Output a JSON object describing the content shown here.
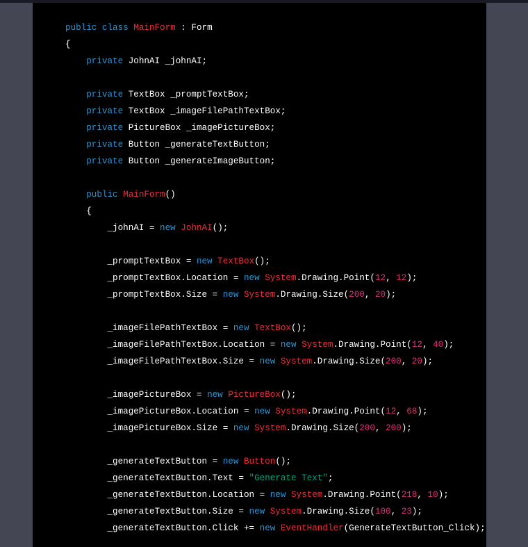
{
  "colors": {
    "keyword": "#2e95d3",
    "type": "#f22c3d",
    "number": "#df3079",
    "string": "#00a67d",
    "plain": "#ffffff"
  },
  "code_lines": [
    [
      [
        "kw",
        "public class "
      ],
      [
        "ty",
        "MainForm"
      ],
      [
        "pl",
        " : Form"
      ]
    ],
    [
      [
        "pl",
        "{"
      ]
    ],
    [
      [
        "kw",
        "    private "
      ],
      [
        "pl",
        "JohnAI _johnAI;"
      ]
    ],
    [],
    [
      [
        "kw",
        "    private "
      ],
      [
        "pl",
        "TextBox _promptTextBox;"
      ]
    ],
    [
      [
        "kw",
        "    private "
      ],
      [
        "pl",
        "TextBox _imageFilePathTextBox;"
      ]
    ],
    [
      [
        "kw",
        "    private "
      ],
      [
        "pl",
        "PictureBox _imagePictureBox;"
      ]
    ],
    [
      [
        "kw",
        "    private "
      ],
      [
        "pl",
        "Button _generateTextButton;"
      ]
    ],
    [
      [
        "kw",
        "    private "
      ],
      [
        "pl",
        "Button _generateImageButton;"
      ]
    ],
    [],
    [
      [
        "kw",
        "    public "
      ],
      [
        "ty",
        "MainForm"
      ],
      [
        "pl",
        "()"
      ]
    ],
    [
      [
        "pl",
        "    {"
      ]
    ],
    [
      [
        "pl",
        "        _johnAI = "
      ],
      [
        "kw",
        "new "
      ],
      [
        "ty",
        "JohnAI"
      ],
      [
        "pl",
        "();"
      ]
    ],
    [],
    [
      [
        "pl",
        "        _promptTextBox = "
      ],
      [
        "kw",
        "new "
      ],
      [
        "ty",
        "TextBox"
      ],
      [
        "pl",
        "();"
      ]
    ],
    [
      [
        "pl",
        "        _promptTextBox.Location = "
      ],
      [
        "kw",
        "new "
      ],
      [
        "ty",
        "System"
      ],
      [
        "pl",
        ".Drawing.Point("
      ],
      [
        "num",
        "12"
      ],
      [
        "pl",
        ", "
      ],
      [
        "num",
        "12"
      ],
      [
        "pl",
        ");"
      ]
    ],
    [
      [
        "pl",
        "        _promptTextBox.Size = "
      ],
      [
        "kw",
        "new "
      ],
      [
        "ty",
        "System"
      ],
      [
        "pl",
        ".Drawing.Size("
      ],
      [
        "num",
        "200"
      ],
      [
        "pl",
        ", "
      ],
      [
        "num",
        "20"
      ],
      [
        "pl",
        ");"
      ]
    ],
    [],
    [
      [
        "pl",
        "        _imageFilePathTextBox = "
      ],
      [
        "kw",
        "new "
      ],
      [
        "ty",
        "TextBox"
      ],
      [
        "pl",
        "();"
      ]
    ],
    [
      [
        "pl",
        "        _imageFilePathTextBox.Location = "
      ],
      [
        "kw",
        "new "
      ],
      [
        "ty",
        "System"
      ],
      [
        "pl",
        ".Drawing.Point("
      ],
      [
        "num",
        "12"
      ],
      [
        "pl",
        ", "
      ],
      [
        "num",
        "40"
      ],
      [
        "pl",
        ");"
      ]
    ],
    [
      [
        "pl",
        "        _imageFilePathTextBox.Size = "
      ],
      [
        "kw",
        "new "
      ],
      [
        "ty",
        "System"
      ],
      [
        "pl",
        ".Drawing.Size("
      ],
      [
        "num",
        "200"
      ],
      [
        "pl",
        ", "
      ],
      [
        "num",
        "20"
      ],
      [
        "pl",
        ");"
      ]
    ],
    [],
    [
      [
        "pl",
        "        _imagePictureBox = "
      ],
      [
        "kw",
        "new "
      ],
      [
        "ty",
        "PictureBox"
      ],
      [
        "pl",
        "();"
      ]
    ],
    [
      [
        "pl",
        "        _imagePictureBox.Location = "
      ],
      [
        "kw",
        "new "
      ],
      [
        "ty",
        "System"
      ],
      [
        "pl",
        ".Drawing.Point("
      ],
      [
        "num",
        "12"
      ],
      [
        "pl",
        ", "
      ],
      [
        "num",
        "68"
      ],
      [
        "pl",
        ");"
      ]
    ],
    [
      [
        "pl",
        "        _imagePictureBox.Size = "
      ],
      [
        "kw",
        "new "
      ],
      [
        "ty",
        "System"
      ],
      [
        "pl",
        ".Drawing.Size("
      ],
      [
        "num",
        "200"
      ],
      [
        "pl",
        ", "
      ],
      [
        "num",
        "200"
      ],
      [
        "pl",
        ");"
      ]
    ],
    [],
    [
      [
        "pl",
        "        _generateTextButton = "
      ],
      [
        "kw",
        "new "
      ],
      [
        "ty",
        "Button"
      ],
      [
        "pl",
        "();"
      ]
    ],
    [
      [
        "pl",
        "        _generateTextButton.Text = "
      ],
      [
        "str",
        "\"Generate Text\""
      ],
      [
        "pl",
        ";"
      ]
    ],
    [
      [
        "pl",
        "        _generateTextButton.Location = "
      ],
      [
        "kw",
        "new "
      ],
      [
        "ty",
        "System"
      ],
      [
        "pl",
        ".Drawing.Point("
      ],
      [
        "num",
        "218"
      ],
      [
        "pl",
        ", "
      ],
      [
        "num",
        "10"
      ],
      [
        "pl",
        ");"
      ]
    ],
    [
      [
        "pl",
        "        _generateTextButton.Size = "
      ],
      [
        "kw",
        "new "
      ],
      [
        "ty",
        "System"
      ],
      [
        "pl",
        ".Drawing.Size("
      ],
      [
        "num",
        "100"
      ],
      [
        "pl",
        ", "
      ],
      [
        "num",
        "23"
      ],
      [
        "pl",
        ");"
      ]
    ],
    [
      [
        "pl",
        "        _generateTextButton.Click += "
      ],
      [
        "kw",
        "new "
      ],
      [
        "ty",
        "EventHandler"
      ],
      [
        "pl",
        "(GenerateTextButton_Click);"
      ]
    ]
  ]
}
